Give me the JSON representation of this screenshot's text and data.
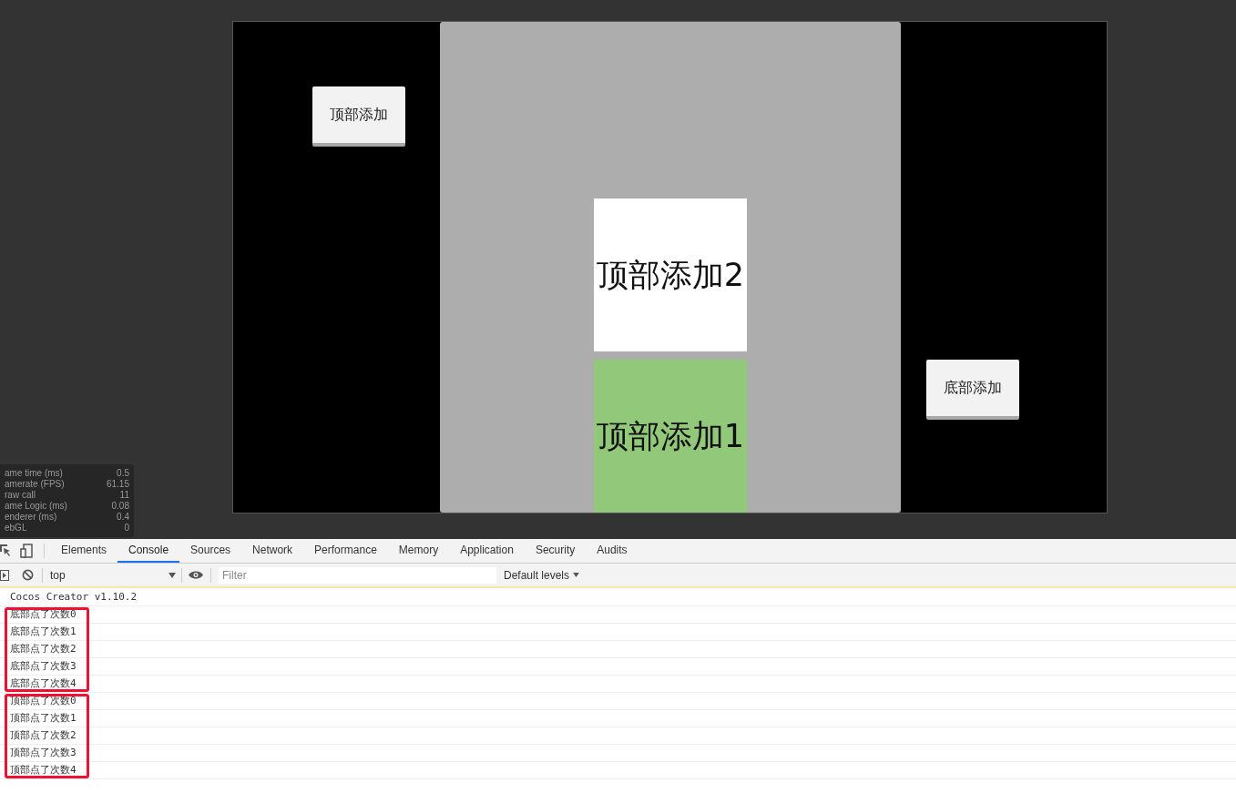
{
  "game": {
    "top_button": "顶部添加",
    "bottom_button": "底部添加",
    "blocks": [
      {
        "label": "顶部添加2",
        "color": "#ffffff"
      },
      {
        "label": "顶部添加1",
        "color": "#92c87a"
      }
    ]
  },
  "stats": [
    {
      "label": "ame time (ms)",
      "value": "0.5"
    },
    {
      "label": "amerate (FPS)",
      "value": "61.15"
    },
    {
      "label": "raw call",
      "value": "11"
    },
    {
      "label": "ame Logic (ms)",
      "value": "0.08"
    },
    {
      "label": "enderer (ms)",
      "value": "0.4"
    },
    {
      "label": "ebGL",
      "value": "0"
    }
  ],
  "devtools": {
    "tabs": [
      {
        "label": "Elements",
        "selected": false
      },
      {
        "label": "Console",
        "selected": true
      },
      {
        "label": "Sources",
        "selected": false
      },
      {
        "label": "Network",
        "selected": false
      },
      {
        "label": "Performance",
        "selected": false
      },
      {
        "label": "Memory",
        "selected": false
      },
      {
        "label": "Application",
        "selected": false
      },
      {
        "label": "Security",
        "selected": false
      },
      {
        "label": "Audits",
        "selected": false
      }
    ],
    "context": "top",
    "filter": {
      "placeholder": "Filter"
    },
    "levels": "Default levels"
  },
  "console": [
    {
      "highlighted": false,
      "lines": [
        "Cocos Creator v1.10.2"
      ]
    },
    {
      "highlighted": true,
      "lines": [
        "底部点了次数0",
        "底部点了次数1",
        "底部点了次数2",
        "底部点了次数3",
        "底部点了次数4"
      ]
    },
    {
      "highlighted": true,
      "lines": [
        "顶部点了次数0",
        "顶部点了次数1",
        "顶部点了次数2",
        "顶部点了次数3",
        "顶部点了次数4"
      ]
    }
  ]
}
